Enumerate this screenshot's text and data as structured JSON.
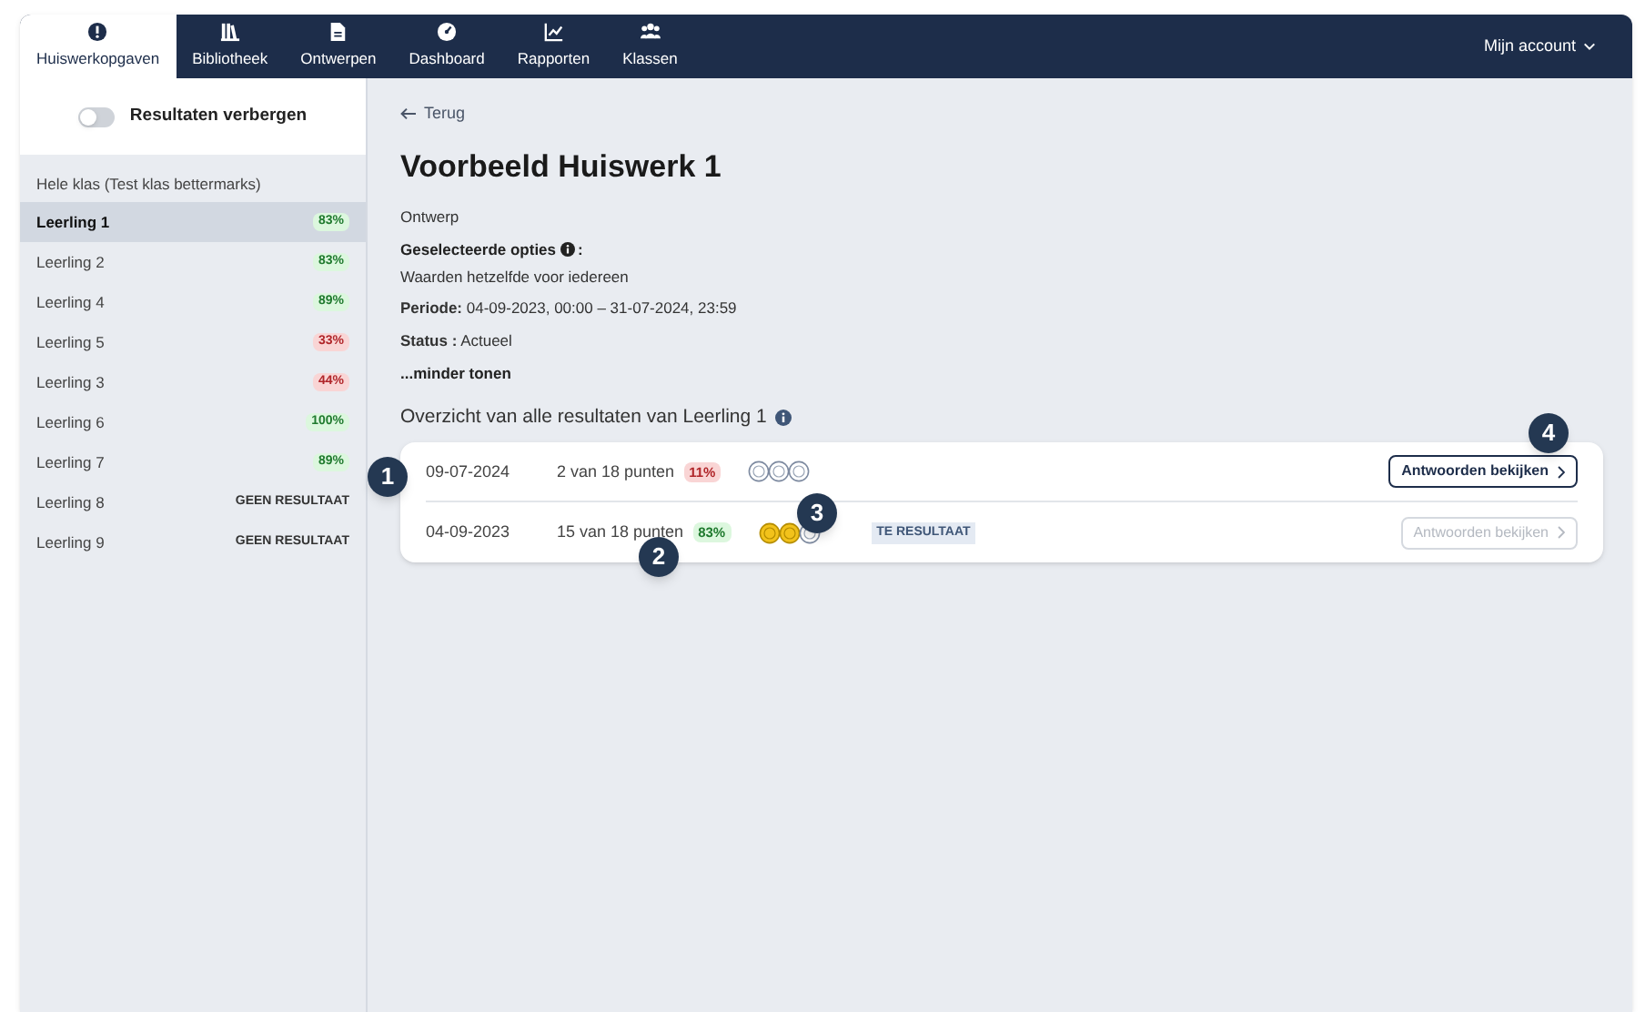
{
  "nav": {
    "tabs": [
      {
        "label": "Huiswerkopgaven",
        "kind": "alert",
        "selected": true
      },
      {
        "label": "Bibliotheek",
        "kind": "books",
        "selected": false
      },
      {
        "label": "Ontwerpen",
        "kind": "file",
        "selected": false
      },
      {
        "label": "Dashboard",
        "kind": "gauge",
        "selected": false
      },
      {
        "label": "Rapporten",
        "kind": "chart",
        "selected": false
      },
      {
        "label": "Klassen",
        "kind": "people",
        "selected": false
      }
    ],
    "account": "Mijn account"
  },
  "sidebar": {
    "toggle": {
      "label": "Resultaten verbergen",
      "on": false
    },
    "class_label": "Hele klas (Test klas bettermarks)",
    "students": [
      {
        "name": "Leerling 1",
        "result": "83%",
        "kind": "pass",
        "selected": true
      },
      {
        "name": "Leerling 2",
        "result": "83%",
        "kind": "pass",
        "selected": false
      },
      {
        "name": "Leerling 4",
        "result": "89%",
        "kind": "pass",
        "selected": false
      },
      {
        "name": "Leerling 5",
        "result": "33%",
        "kind": "fail",
        "selected": false
      },
      {
        "name": "Leerling 3",
        "result": "44%",
        "kind": "fail",
        "selected": false
      },
      {
        "name": "Leerling 6",
        "result": "100%",
        "kind": "pass",
        "selected": false
      },
      {
        "name": "Leerling 7",
        "result": "89%",
        "kind": "pass",
        "selected": false
      },
      {
        "name": "Leerling 8",
        "result": "GEEN RESULTAAT",
        "kind": "none",
        "selected": false
      },
      {
        "name": "Leerling 9",
        "result": "GEEN RESULTAAT",
        "kind": "none",
        "selected": false
      }
    ]
  },
  "main": {
    "back": "Terug",
    "title": "Voorbeeld Huiswerk 1",
    "status_line": "Ontwerp",
    "options_label": "Geselecteerde opties",
    "options_colon": ":",
    "options_value": "Waarden hetzelfde voor iedereen",
    "period": "**Periode:** 04-09-2023, 00:00 – 31-07-2024, 23:59",
    "status": "**Status :** Actueel",
    "less": "...minder tonen",
    "overview": "Overzicht van alle resultaten van Leerling 1",
    "results": [
      {
        "date": "09-07-2024",
        "points": "2 van 18 punten",
        "result": "11%",
        "kind": "fail",
        "stars": 0,
        "button": "Antwoorden bekijken",
        "disabled": false
      },
      {
        "date": "04-09-2023",
        "points": "15 van 18 punten",
        "result": "83%",
        "kind": "pass",
        "stars": 2,
        "tag": "TE RESULTAAT",
        "button": "Antwoorden bekijken",
        "disabled": true
      }
    ]
  },
  "callouts": [
    "1",
    "2",
    "3",
    "4"
  ]
}
